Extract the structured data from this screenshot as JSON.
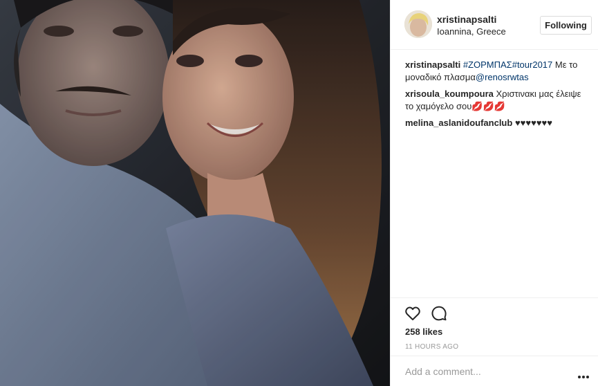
{
  "post": {
    "photo": {
      "alt": ""
    },
    "header": {
      "username": "xristinapsalti",
      "location": "Ioannina, Greece",
      "follow_label": "Following"
    },
    "caption": {
      "username": "xristinapsalti",
      "hashtag1": "#ΖΟΡΜΠΑΣ",
      "hashtag2": "#tour2017",
      "text": " Με το μοναδικό πλασμα",
      "mention": "@renosrwtas"
    },
    "comments": [
      {
        "username": "xrisoula_koumpoura",
        "text": "Χριστινακι μας έλειψε το χαμόγελο σου💋💋💋"
      },
      {
        "username": "melina_aslanidoufanclub",
        "text": "♥♥♥♥♥♥♥"
      }
    ],
    "actions": {
      "like_icon": "heart-icon",
      "comment_icon": "speech-bubble-icon"
    },
    "likes": "258 likes",
    "time": "11 HOURS AGO",
    "add_comment": {
      "placeholder": "Add a comment...",
      "more_icon": "ellipsis-icon"
    }
  }
}
